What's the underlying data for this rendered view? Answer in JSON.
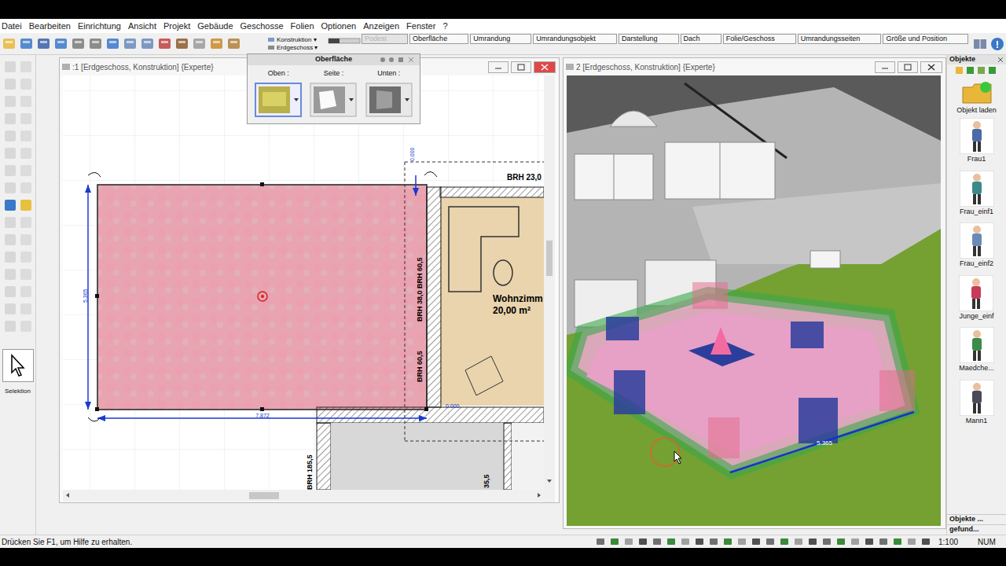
{
  "menu": [
    "Datei",
    "Bearbeiten",
    "Einrichtung",
    "Ansicht",
    "Projekt",
    "Gebäude",
    "Geschosse",
    "Folien",
    "Optionen",
    "Anzeigen",
    "Fenster",
    "?"
  ],
  "toolbar": {
    "view_mode": "Konstruktion ▾",
    "floor": "Erdgeschoss ▾",
    "tabs": [
      {
        "label": "Podest",
        "disabled": true
      },
      {
        "label": "Oberfläche",
        "disabled": false
      },
      {
        "label": "Umrandung",
        "disabled": false
      },
      {
        "label": "Umrandungsobjekt",
        "disabled": false
      },
      {
        "label": "Darstellung",
        "disabled": false
      },
      {
        "label": "Dach",
        "disabled": false
      },
      {
        "label": "Folie/Geschoss",
        "disabled": false
      },
      {
        "label": "Umrandungsseiten",
        "disabled": false
      },
      {
        "label": "Größe und Position",
        "disabled": false
      }
    ]
  },
  "surface_panel": {
    "title": "Oberfläche",
    "labels": [
      "Oben :",
      "Seite :",
      "Unten :"
    ]
  },
  "plan_window": {
    "title": ":1 [Erdgeschoss, Konstruktion] {Experte}",
    "labels": {
      "brh_top": "BRH 23,0",
      "room_name": "Wohnzimm",
      "room_area": "20,00 m²",
      "brh_left1": "BRH 38,0 BRH 60,5",
      "brh_left2": "BRH 60,5",
      "brh_bottom": "BRH 185,5",
      "dim_small": "35,5",
      "dim_left": "5.365",
      "dim_bottom": "7.872",
      "level_top": "0.000",
      "level_bottom": "0.000"
    }
  },
  "view3d_window": {
    "title": "2 [Erdgeschoss, Konstruktion] {Experte}",
    "dim": "5.365"
  },
  "left_tools": {
    "active_tool": "Selektion"
  },
  "objects": {
    "title": "Objekte",
    "load": "Objekt laden",
    "items": [
      "Frau1",
      "Frau_einf1",
      "Frau_einf2",
      "Junge_einf",
      "Maedche...",
      "Mann1"
    ],
    "footer": [
      "Objekte ...",
      "gefund..."
    ]
  },
  "status_bar": {
    "message": "Drücken Sie F1, um Hilfe zu erhalten.",
    "scale": "1:100",
    "num": "NUM"
  }
}
